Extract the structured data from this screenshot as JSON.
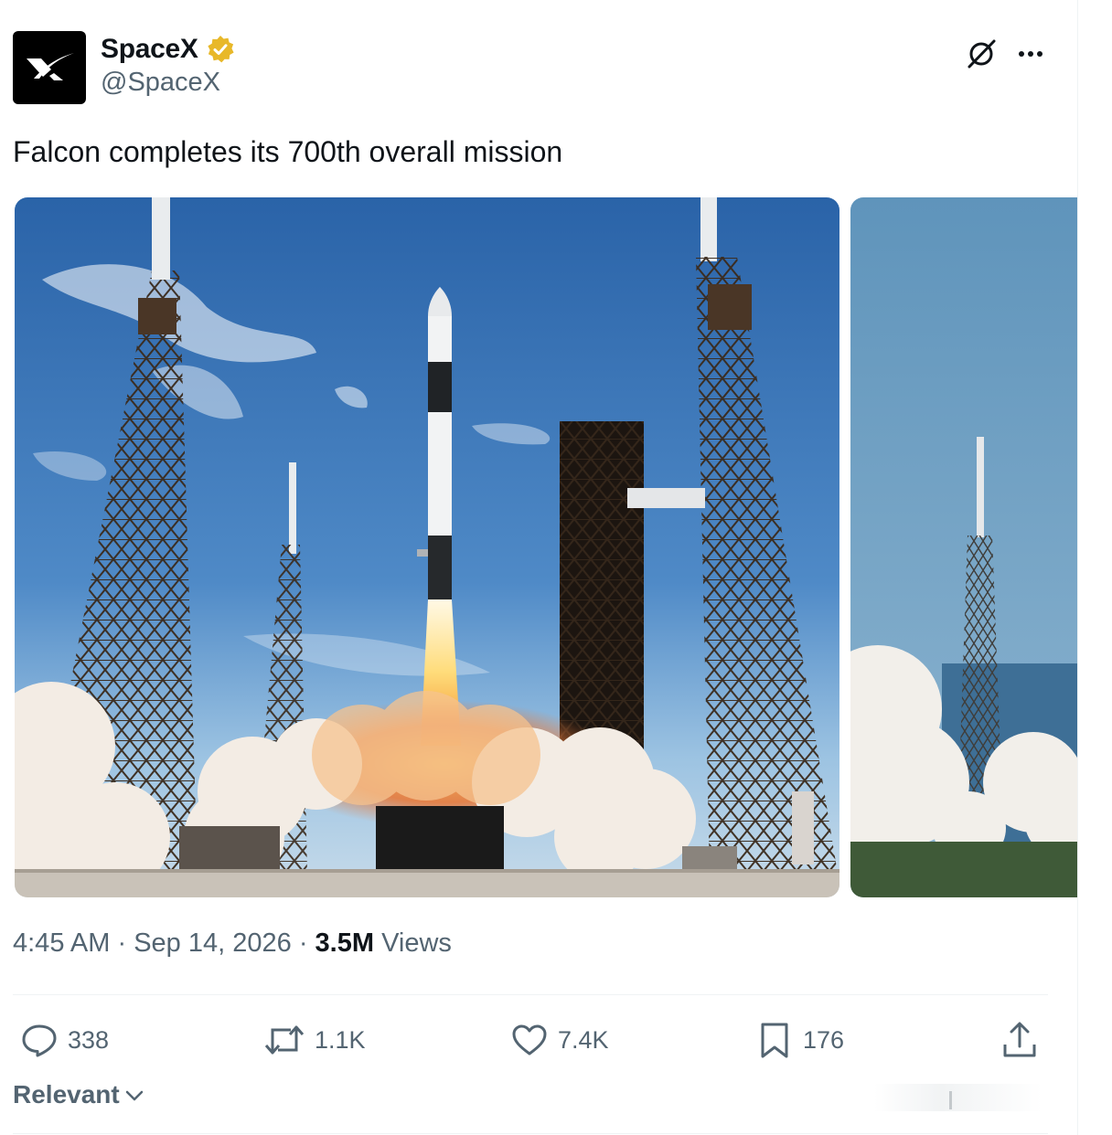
{
  "author": {
    "display_name": "SpaceX",
    "handle": "@SpaceX",
    "verified_badge": "verified-gold-badge"
  },
  "tweet": {
    "text": "Falcon completes its 700th overall mission",
    "time": "4:45 AM",
    "separator": "·",
    "date": "Sep 14, 2026",
    "views_count": "3.5M",
    "views_label": "Views"
  },
  "media": [
    {
      "alt": "Falcon rocket lifting off from launch pad between lightning towers"
    },
    {
      "alt": "Launch pad tower with exhaust cloud, ocean in background"
    }
  ],
  "actions": {
    "replies": "338",
    "reposts": "1.1K",
    "likes": "7.4K",
    "bookmarks": "176"
  },
  "sort": {
    "label": "Relevant"
  },
  "colors": {
    "text_primary": "#0f1419",
    "text_secondary": "#536471",
    "verified_gold": "#e8b829",
    "divider": "#eff3f4"
  },
  "icons": [
    "grok-icon",
    "more-icon",
    "reply-icon",
    "repost-icon",
    "like-icon",
    "bookmark-icon",
    "share-icon",
    "chevron-down-icon"
  ]
}
